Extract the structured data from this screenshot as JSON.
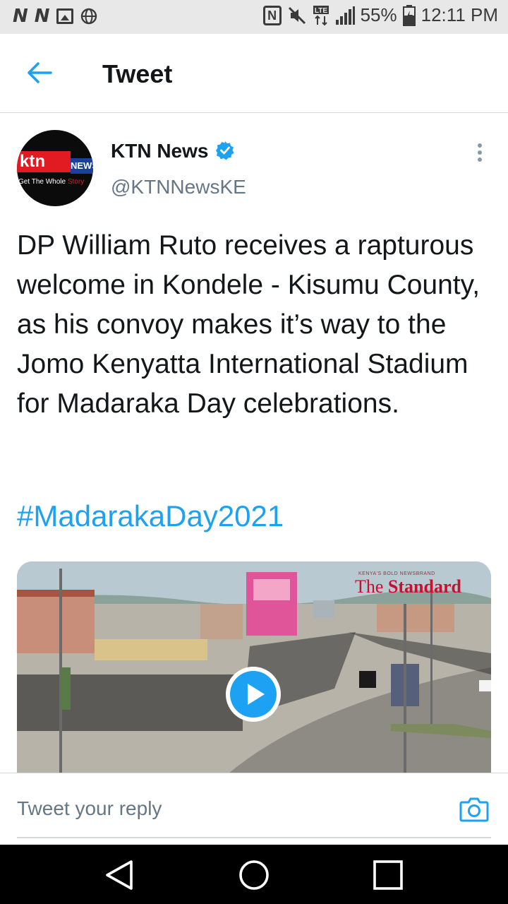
{
  "status_bar": {
    "battery": "55%",
    "time": "12:11 PM",
    "lte": "LTE",
    "nfc": "N"
  },
  "header": {
    "title": "Tweet"
  },
  "tweet": {
    "author_name": "KTN News",
    "author_handle": "@KTNNewsKE",
    "text": "DP William Ruto receives a rapturous welcome in Kondele - Kisumu County, as his convoy makes it’s way to the Jomo Kenyatta International Stadium for Madaraka Day celebrations.",
    "hashtag": "#MadarakaDay2021",
    "avatar": {
      "logo_main": "ktn",
      "logo_sub": "NEWS",
      "tagline_a": "Get The Whole ",
      "tagline_b": "Story"
    },
    "media": {
      "watermark_small": "KENYA'S BOLD NEWSBRAND",
      "watermark_a": "The ",
      "watermark_b": "Standard"
    }
  },
  "reply": {
    "placeholder": "Tweet your reply"
  },
  "colors": {
    "accent": "#1da1f2",
    "text": "#14171a",
    "muted": "#657786"
  },
  "icons": [
    "n-icon",
    "image-icon",
    "globe-icon",
    "nfc-icon",
    "mute-icon",
    "lte-icon",
    "signal-icon",
    "battery-icon",
    "back-arrow-icon",
    "verified-icon",
    "more-vertical-icon",
    "play-icon",
    "camera-icon",
    "nav-back-icon",
    "nav-home-icon",
    "nav-recent-icon"
  ]
}
